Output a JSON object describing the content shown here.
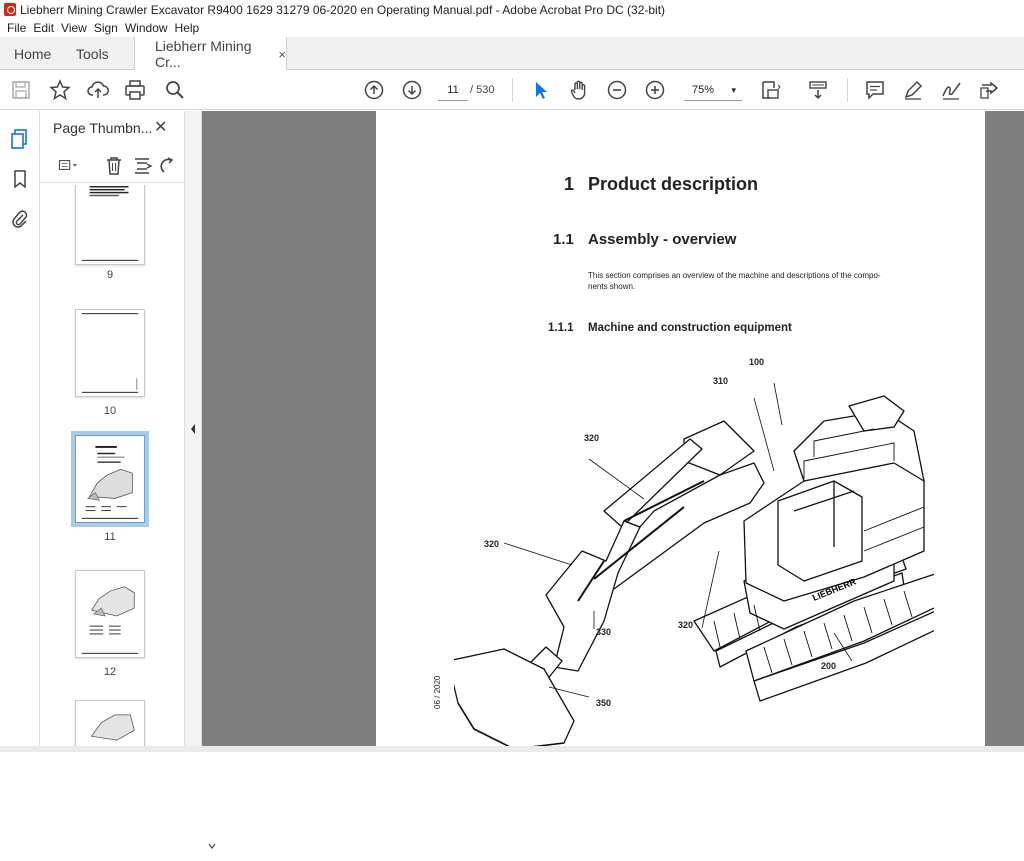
{
  "window": {
    "title": "Liebherr Mining Crawler Excavator R9400 1629 31279 06-2020 en Operating Manual.pdf - Adobe Acrobat Pro DC (32-bit)"
  },
  "menu": [
    "File",
    "Edit",
    "View",
    "Sign",
    "Window",
    "Help"
  ],
  "tabs": {
    "home": "Home",
    "tools": "Tools",
    "document": "Liebherr Mining Cr...",
    "close": "×"
  },
  "toolbar": {
    "current_page": "11",
    "page_total": "/  530",
    "zoom": "75%",
    "zoom_caret": "▾",
    "icons": [
      "save-icon",
      "star-icon",
      "upload-cloud-icon",
      "print-icon",
      "zoom-search-icon",
      "page-up-icon",
      "page-down-icon",
      "select-cursor-icon",
      "hand-icon",
      "zoom-out-icon",
      "zoom-in-icon",
      "fit-page-icon",
      "scroll-mode-icon",
      "comment-icon",
      "highlight-pen-icon",
      "sign-icon",
      "share-icon"
    ]
  },
  "thumbnails_panel": {
    "title": "Page Thumbn...",
    "close": "✕",
    "pages": [
      {
        "number": "9",
        "selected": false
      },
      {
        "number": "10",
        "selected": false
      },
      {
        "number": "11",
        "selected": true
      },
      {
        "number": "12",
        "selected": false
      }
    ]
  },
  "page": {
    "chapter_number": "1",
    "chapter_title": "Product description",
    "section_number": "1.1",
    "section_title": "Assembly - overview",
    "body_line1": "This section comprises an overview of the machine and descriptions of the compo-",
    "body_line2": "nents shown.",
    "subsection_number": "1.1.1",
    "subsection_title": "Machine and construction equipment",
    "side_date": "06 / 2020",
    "callouts": {
      "c100": "100",
      "c310": "310",
      "c320a": "320",
      "c320b": "320",
      "c320c": "320",
      "c330": "330",
      "c350": "350",
      "c200": "200"
    },
    "brand_on_machine": "LIEBHERR"
  },
  "colors": {
    "accent": "#1473e6",
    "doc_background": "#7f7f7f",
    "selected_thumb": "#a9cbe8",
    "acrobat_red": "#d6271d"
  }
}
